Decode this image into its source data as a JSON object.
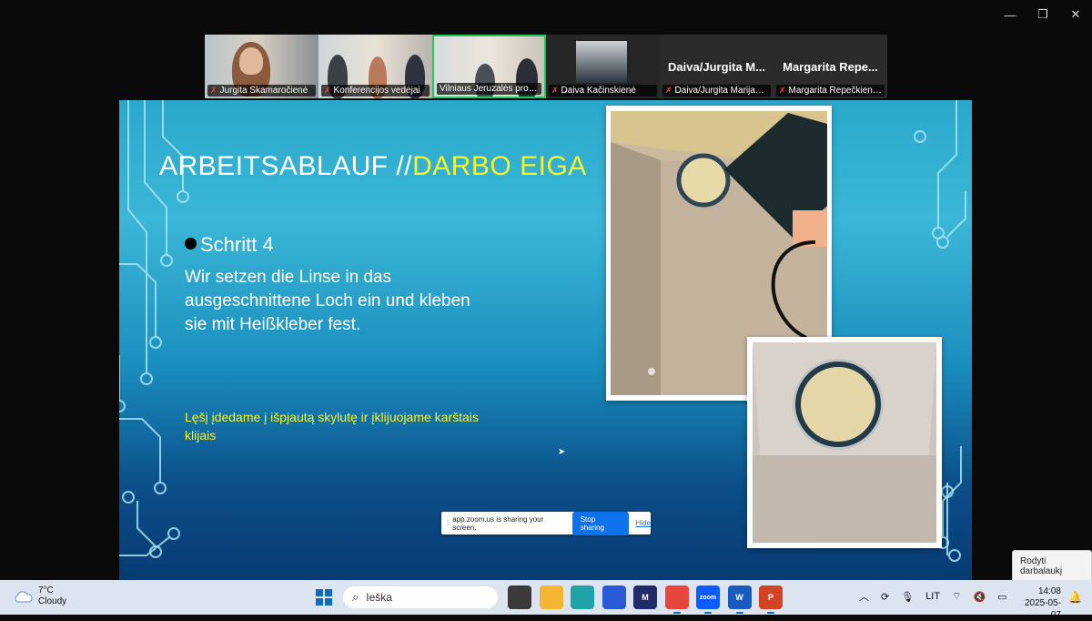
{
  "window_controls": [
    "—",
    "❐",
    "✕"
  ],
  "participants": [
    {
      "name": "Jurgita Skamaročienė"
    },
    {
      "name": "Konferencijos vedėjai"
    },
    {
      "name": "Vilniaus Jeruzalės progim..."
    },
    {
      "name": "Daiva Kačinskienė"
    },
    {
      "name": "Daiva/Jurgita Marijam...",
      "big_name": "Daiva/Jurgita  M..."
    },
    {
      "name": "Margarita Repečkienė, ...",
      "big_name": "Margarita  Repe..."
    }
  ],
  "slide": {
    "title_white": "ARBEITSABLAUF //",
    "title_yellow": "DARBO EIGA",
    "step": "Schritt 4",
    "body_de": "Wir setzen die Linse in das ausgeschnittene Loch ein und kleben sie mit Heißkleber fest.",
    "body_lt": "Lęšį įdedame į išpjautą skylutę ir įklijuojame karštais klijais"
  },
  "share_bar": {
    "message": "app.zoom.us is sharing your screen.",
    "stop_label": "Stop sharing",
    "hide_label": "Hide"
  },
  "tooltip": "Rodyti darbalaukį",
  "taskbar": {
    "weather_temp": "7°C",
    "weather_desc": "Cloudy",
    "search_placeholder": "Ieška",
    "language": "LIT",
    "time": "14:08",
    "date": "2025-05-07",
    "apps": [
      {
        "name": "task-view",
        "color": "#3a3a3a",
        "label": ""
      },
      {
        "name": "file-explorer",
        "color": "#f2b632",
        "label": ""
      },
      {
        "name": "edge",
        "color": "#1fa2a8",
        "label": ""
      },
      {
        "name": "store",
        "color": "#2a5bd7",
        "label": ""
      },
      {
        "name": "copilot",
        "color": "#222c6b",
        "label": "M"
      },
      {
        "name": "chrome",
        "color": "#e8453c",
        "label": ""
      },
      {
        "name": "zoom",
        "color": "#0b5cff",
        "label": "zoom"
      },
      {
        "name": "word",
        "color": "#185abd",
        "label": "W"
      },
      {
        "name": "powerpoint",
        "color": "#d04423",
        "label": "P"
      }
    ]
  }
}
